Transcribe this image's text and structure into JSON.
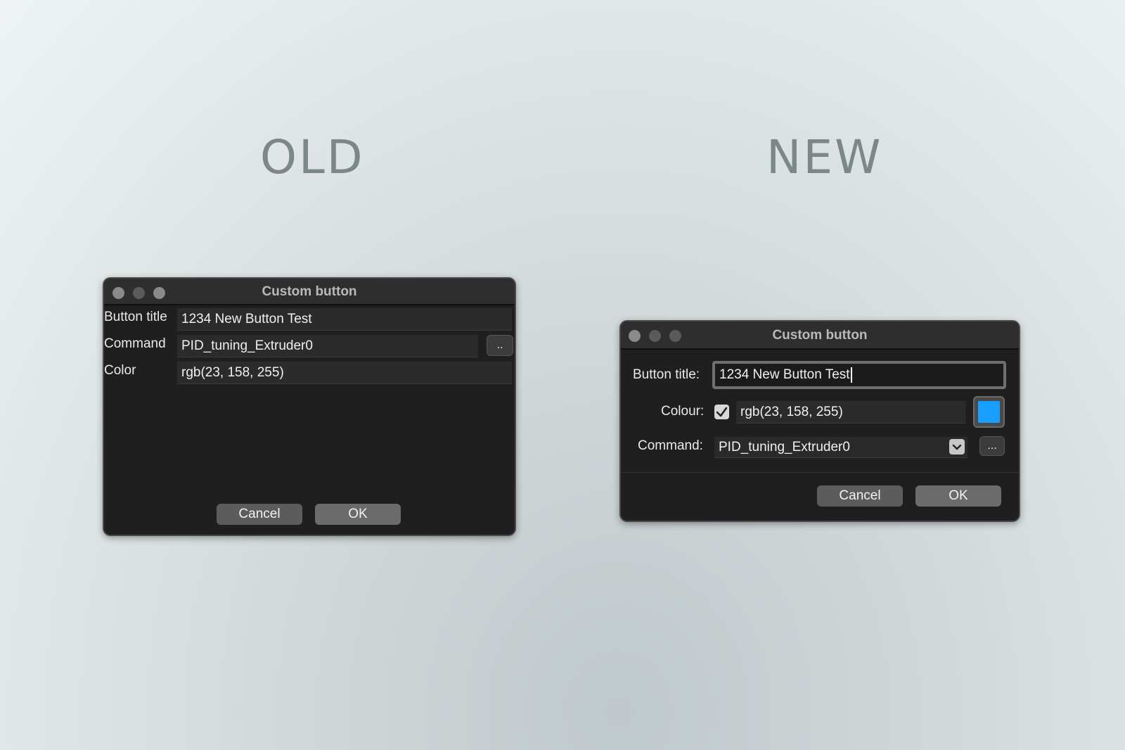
{
  "headings": {
    "old": "OLD",
    "new": "NEW"
  },
  "old_dialog": {
    "title": "Custom button",
    "button_title_label": "Button title",
    "button_title_value": "1234 New Button Test",
    "command_label": "Command",
    "command_value": "PID_tuning_Extruder0",
    "browse_label": "..",
    "color_label": "Color",
    "color_value": "rgb(23, 158, 255)",
    "cancel_label": "Cancel",
    "ok_label": "OK"
  },
  "new_dialog": {
    "title": "Custom button",
    "button_title_label": "Button title:",
    "button_title_value": "1234 New Button Test",
    "colour_label": "Colour:",
    "colour_checked": true,
    "colour_value": "rgb(23, 158, 255)",
    "swatch_color": "#179eff",
    "command_label": "Command:",
    "command_value": "PID_tuning_Extruder0",
    "browse_label": "...",
    "cancel_label": "Cancel",
    "ok_label": "OK"
  },
  "icons": {
    "window_close": "circle",
    "window_minimize": "circle",
    "window_zoom": "circle",
    "checkbox": "check-mark",
    "dropdown": "chevron-down"
  }
}
